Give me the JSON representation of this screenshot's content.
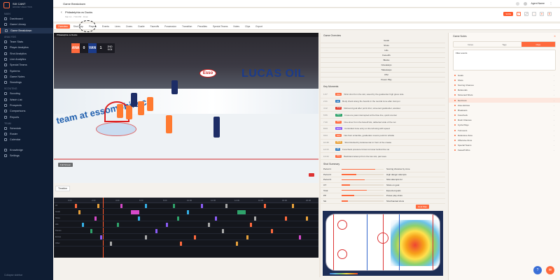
{
  "sidebar": {
    "brand": "SIX CANT",
    "brand_sub": "HOCKEY ANALYTICS",
    "sections": [
      {
        "label": "MAIN",
        "items": [
          "Dashboard",
          "Game Library",
          "Game Breakdown"
        ]
      },
      {
        "label": "ANALYSIS",
        "items": [
          "Team Stats",
          "Player Analytics",
          "Shot Analytics",
          "Line Analytics",
          "Special Teams",
          "Systems",
          "Game Notes",
          "Standings"
        ]
      },
      {
        "label": "SCOUTING",
        "items": [
          "Scouting",
          "Watch List",
          "Prospects",
          "Comparisons",
          "Reports"
        ]
      },
      {
        "label": "TEAM",
        "items": [
          "Schedule",
          "Roster",
          "Calendar"
        ]
      },
      {
        "label": "",
        "items": [
          "Knowledge",
          "Settings"
        ]
      }
    ],
    "active_item": "Game Breakdown",
    "footer": "Collapse sidebar"
  },
  "topbar": {
    "title": "Game Breakdown",
    "user": "Agent Name"
  },
  "subheader": {
    "title": "Philadelphia vs Ducks",
    "meta": "Mar 12 · 7:00 PM · Final",
    "live_badge": "SAVE"
  },
  "tabs": [
    "Overview",
    "Shot Map",
    "Players",
    "Events",
    "Lines",
    "Zones",
    "Goalie",
    "Faceoffs",
    "Possession",
    "Transition",
    "Penalties",
    "Special Teams",
    "Notes",
    "Clips",
    "Export"
  ],
  "active_tab": "Overview",
  "video": {
    "scoreboard": {
      "away": "ANA",
      "away_score": "0",
      "home": "VAN",
      "home_score": "1",
      "clock": "2ND 9:04"
    },
    "overlay_btn": "Full Screen",
    "ads": {
      "main": "LUCAS OIL",
      "sponsor": "Esso",
      "rink_text": "team at essomobile.ca"
    }
  },
  "timeline": {
    "label": "Timeline",
    "ticks": [
      "0:00",
      "2:00",
      "4:00",
      "6:00",
      "8:00",
      "10:00",
      "12:00",
      "14:00",
      "16:00",
      "18:00",
      "20:00"
    ],
    "rows": [
      "All",
      "Goals",
      "Shots",
      "Hits",
      "Passes",
      "Entries",
      "Other"
    ]
  },
  "stats": {
    "title": "Game Overview",
    "rows": [
      {
        "l": "",
        "m": "Goals",
        "r": ""
      },
      {
        "l": "",
        "m": "Shots",
        "r": ""
      },
      {
        "l": "",
        "m": "Hits",
        "r": ""
      },
      {
        "l": "",
        "m": "Faceoffs",
        "r": ""
      },
      {
        "l": "",
        "m": "Blocks",
        "r": ""
      },
      {
        "l": "",
        "m": "Giveaways",
        "r": ""
      },
      {
        "l": "",
        "m": "Takeaways",
        "r": ""
      },
      {
        "l": "",
        "m": "PIM",
        "r": ""
      },
      {
        "l": "",
        "m": "Power Play",
        "r": ""
      }
    ]
  },
  "events": {
    "title": "Key Moments",
    "items": [
      {
        "time": "1:07",
        "tag": "Shot",
        "color": "#ff6a3d",
        "txt": "Wrist shot from the slot, saved by the goaltender high glove side"
      },
      {
        "time": "2:41",
        "tag": "Hit",
        "color": "#3b82c4",
        "txt": "Body check along the boards in the neutral zone after dump-in"
      },
      {
        "time": "4:12",
        "tag": "Goal",
        "color": "#e0392b",
        "txt": "Rebound goal after point shot, screened goaltender, assisted"
      },
      {
        "time": "5:55",
        "tag": "Pass",
        "color": "#2fa36b",
        "txt": "Cross-ice pass intercepted at the blue line, quick counter"
      },
      {
        "time": "7:20",
        "tag": "Shot",
        "color": "#ff6a3d",
        "txt": "One-timer from the faceoff dot, deflected wide of the net"
      },
      {
        "time": "8:03",
        "tag": "Entry",
        "color": "#8b5cf6",
        "txt": "Controlled zone entry on the left wing with speed"
      },
      {
        "time": "9:04",
        "tag": "Shot",
        "color": "#ff6a3d",
        "txt": "Net-front scramble, goaltender covers puck for whistle"
      },
      {
        "time": "10:48",
        "tag": "Block",
        "color": "#e9a23b",
        "txt": "Shot blocked by defenseman in front of the crease"
      },
      {
        "time": "12:15",
        "tag": "Hit",
        "color": "#3b82c4",
        "txt": "Forecheck pressure forces turnover behind the net"
      },
      {
        "time": "13:30",
        "tag": "Shot",
        "color": "#ff6a3d",
        "txt": "Backhand attempt from the low slot, pad save"
      }
    ]
  },
  "shots": {
    "title": "Shot Summary",
    "items": [
      {
        "l": "Period 1",
        "v": 0.8,
        "r": "Scoring chances by zone"
      },
      {
        "l": "Period 2",
        "v": 0.35,
        "r": "High danger attempts"
      },
      {
        "l": "Period 3",
        "v": 0.55,
        "r": "Shot attempts for"
      },
      {
        "l": "OT",
        "v": 0.2,
        "r": "Shots on goal"
      },
      {
        "l": "Total",
        "v": 0.6,
        "r": "Expected goals"
      },
      {
        "l": "PP",
        "v": 0.3,
        "r": "Power play shots"
      },
      {
        "l": "SH",
        "v": 0.15,
        "r": "Shorthanded shots"
      }
    ]
  },
  "rink": {
    "chip": "Heat Map"
  },
  "right_panel": {
    "title": "Game Notes",
    "tabs": [
      "Notes",
      "Tags",
      "Clips"
    ],
    "active_tab": "Clips",
    "filter_label": "Filter events",
    "groups": [
      {
        "label": "Goals",
        "hl": false
      },
      {
        "label": "Shots",
        "hl": false
      },
      {
        "label": "Scoring Chances",
        "hl": false
      },
      {
        "label": "Rebounds",
        "hl": false
      },
      {
        "label": "Screened Shots",
        "hl": false
      },
      {
        "label": "Net Front",
        "hl": true
      },
      {
        "label": "Zone Entries",
        "hl": false
      },
      {
        "label": "Breakouts",
        "hl": false
      },
      {
        "label": "Forecheck",
        "hl": false
      },
      {
        "label": "Rush Chances",
        "hl": false
      },
      {
        "label": "Cycle Plays",
        "hl": false
      },
      {
        "label": "Turnovers",
        "hl": false
      },
      {
        "label": "Defensive Zone",
        "hl": false
      },
      {
        "label": "Offensive Zone",
        "hl": false
      },
      {
        "label": "Special Teams",
        "hl": false
      },
      {
        "label": "Faceoff Wins",
        "hl": false
      }
    ]
  }
}
